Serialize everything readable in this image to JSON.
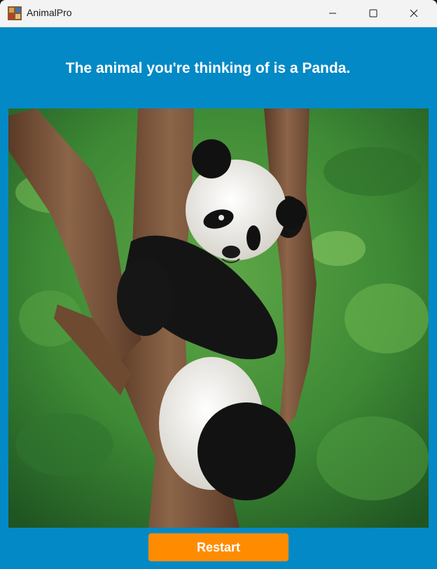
{
  "window": {
    "title": "AnimalPro",
    "icon": "app-icon",
    "controls": [
      "minimize-icon",
      "maximize-icon",
      "close-icon"
    ]
  },
  "result": {
    "message": "The animal you're thinking of is a Panda."
  },
  "image": {
    "subject": "panda-photo"
  },
  "actions": {
    "restart_label": "Restart"
  },
  "colors": {
    "background": "#0289c6",
    "button": "#ff8c00",
    "titlebar": "#f3f3f3"
  }
}
